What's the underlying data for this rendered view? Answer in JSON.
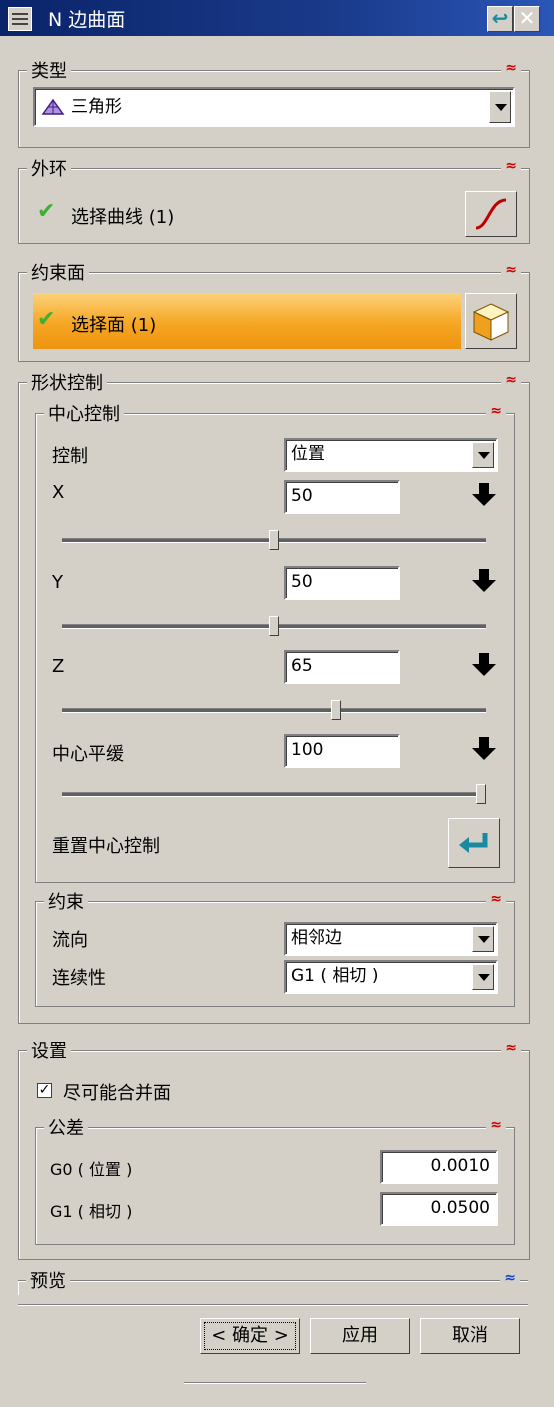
{
  "window": {
    "title": "N 边曲面"
  },
  "type_group": {
    "title": "类型",
    "selected": "三角形"
  },
  "outer_loop": {
    "title": "外环",
    "select_label": "选择曲线 (1)"
  },
  "constraint_face": {
    "title": "约束面",
    "select_label": "选择面 (1)"
  },
  "shape_control": {
    "title": "形状控制",
    "center_control": {
      "title": "中心控制",
      "control_label": "控制",
      "control_value": "位置",
      "x_label": "X",
      "x_value": "50",
      "x_slider": 0.5,
      "y_label": "Y",
      "y_value": "50",
      "y_slider": 0.5,
      "z_label": "Z",
      "z_value": "65",
      "z_slider": 0.65,
      "flat_label": "中心平缓",
      "flat_value": "100",
      "flat_slider": 1.0,
      "reset_label": "重置中心控制"
    },
    "constraint": {
      "title": "约束",
      "flow_label": "流向",
      "flow_value": "相邻边",
      "continuity_label": "连续性",
      "continuity_value": "G1 ( 相切 )"
    }
  },
  "settings": {
    "title": "设置",
    "merge_label": "尽可能合并面",
    "merge_checked": true,
    "tolerance": {
      "title": "公差",
      "g0_label": "G0 ( 位置 )",
      "g0_value": "0.0010",
      "g1_label": "G1 ( 相切 )",
      "g1_value": "0.0500"
    }
  },
  "preview": {
    "title": "预览"
  },
  "buttons": {
    "ok": "< 确定 >",
    "apply": "应用",
    "cancel": "取消"
  },
  "colors": {
    "accent": "#f5a623",
    "check": "#3cb030",
    "collapse": "#d00000"
  }
}
